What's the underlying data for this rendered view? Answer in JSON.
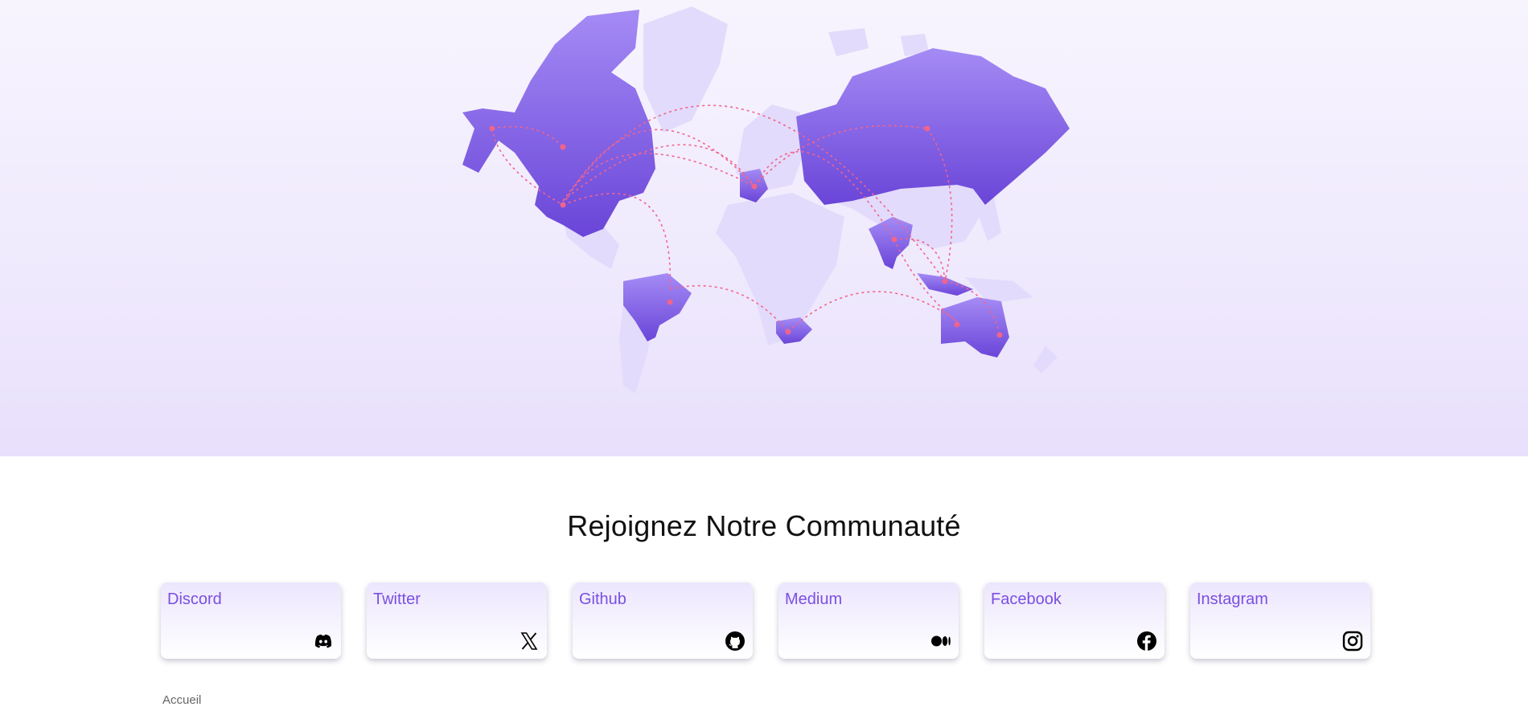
{
  "community": {
    "heading": "Rejoignez Notre Communauté"
  },
  "cards": [
    {
      "label": "Discord",
      "icon": "discord-icon"
    },
    {
      "label": "Twitter",
      "icon": "x-twitter-icon"
    },
    {
      "label": "Github",
      "icon": "github-icon"
    },
    {
      "label": "Medium",
      "icon": "medium-icon"
    },
    {
      "label": "Facebook",
      "icon": "facebook-icon"
    },
    {
      "label": "Instagram",
      "icon": "instagram-icon"
    }
  ],
  "footer": {
    "home_link": "Accueil"
  },
  "colors": {
    "accent": "#7b4fe0",
    "map_highlight": "#6f4cdc",
    "map_base": "#e3dbfb",
    "connection_lines": "#f0648c"
  }
}
